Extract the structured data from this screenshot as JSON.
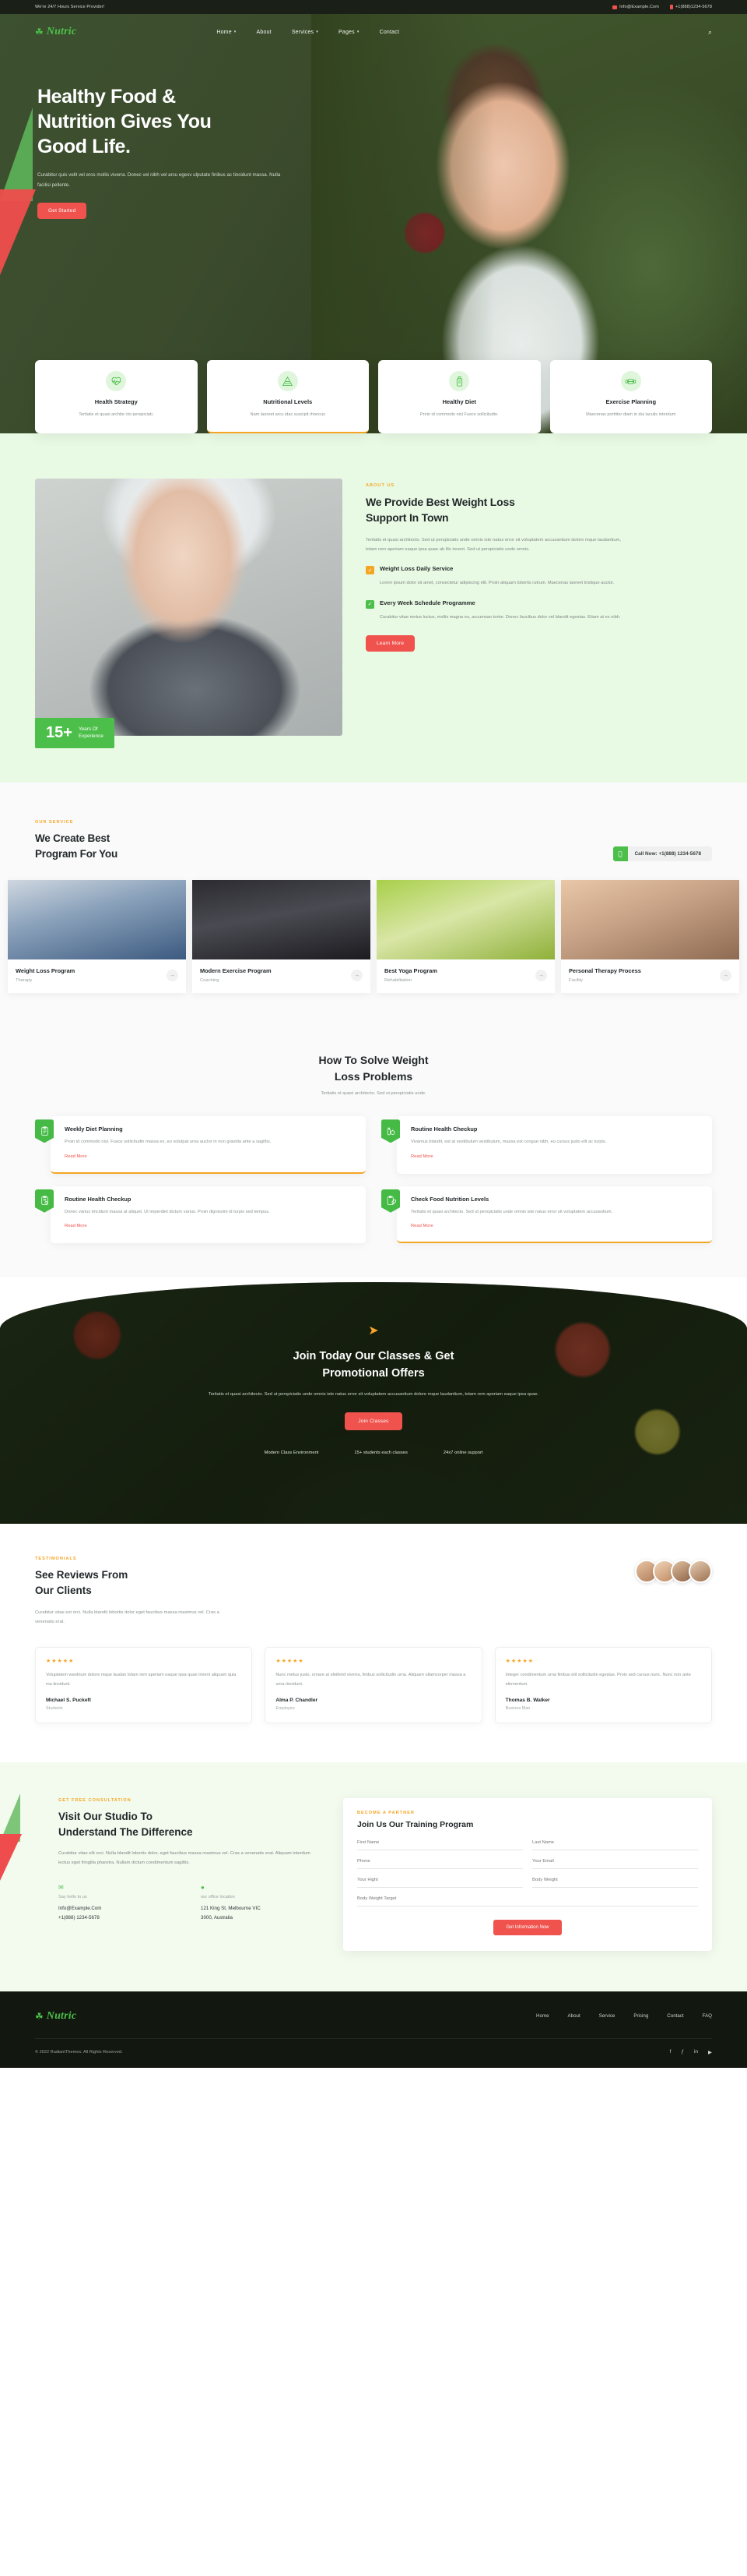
{
  "topbar": {
    "tagline": "We're 24/7 Hours Service Provider!",
    "email": "Info@Example.Com",
    "phone": "+1(888)1234-5678",
    "mail_icon": "mail-icon",
    "phone_icon": "phone-icon"
  },
  "brand": {
    "mark": "☘",
    "name": "Nutric"
  },
  "nav": {
    "items": [
      {
        "label": "Home",
        "caret": "▾"
      },
      {
        "label": "About",
        "caret": ""
      },
      {
        "label": "Services",
        "caret": "▾"
      },
      {
        "label": "Pages",
        "caret": "▾"
      },
      {
        "label": "Contact",
        "caret": ""
      }
    ],
    "search_icon": "⌕"
  },
  "hero": {
    "title": "Healthy Food &\nNutrition Gives You\nGood Life.",
    "desc": "Curabitur quis velit vel eros mollis viverra. Donec vel nibh vel arcu egesv ulputate finibus ac tincidunt massa. Nulla facilisi pellente.",
    "cta": "Get Started"
  },
  "features": [
    {
      "icon": "heartbeat-icon",
      "title": "Health Strategy",
      "desc": "Teritatis et quasi archite cto perspiciati."
    },
    {
      "icon": "food-pyramid-icon",
      "title": "Nutritional Levels",
      "desc": "Nam laoreet arcu idac suscipit rhoncus"
    },
    {
      "icon": "diet-bottle-icon",
      "title": "Healthy Diet",
      "desc": "Proin id commodo nisl Fusce sollicitudin."
    },
    {
      "icon": "dumbbell-icon",
      "title": "Exercise Planning",
      "desc": "Maecenas porttitor diam in dui iaculis interdum"
    }
  ],
  "about": {
    "eyebrow": "ABOUT US",
    "title": "We Provide Best Weight Loss\nSupport In Town",
    "desc": "Teritatis et quasi architecto. Sed ut perspiciatis unde omnis iste natus error sit voluptatem accusantium dolore mque laudantium, totam rem aperiam eaque ipsa quae ab illo invent. Sed ut perspiciatis unde omnis.",
    "badge_number": "15+",
    "badge_label": "Years Of\nExperience",
    "points": [
      {
        "title": "Weight Loss Daily Service",
        "desc": "Lorem ipsum dolor sit amet, consectetur adipiscing elit. Proin aliquam lobortis rutrum. Maecenas laoreet tristique auctor.",
        "color": "#f5a524"
      },
      {
        "title": "Every Week Schedule Programme",
        "desc": "Curabitur vitae metus luctus, mollis magna eu, accumsan tortor. Donec faucibus dolor vel blandit egestas. Etiam at ex nibh.",
        "color": "#4cbf4a"
      }
    ],
    "cta": "Learn More"
  },
  "service": {
    "eyebrow": "OUR SERVICE",
    "title": "We Create Best\nProgram For You",
    "call_label": "Call Now: +1(888) 1234-5678",
    "call_icon": "phone-icon",
    "programs": [
      {
        "title": "Weight Loss Program",
        "sub": "Therapy",
        "arrow": "→"
      },
      {
        "title": "Modern Exercise Program",
        "sub": "Coaching",
        "arrow": "→"
      },
      {
        "title": "Best Yoga Program",
        "sub": "Rehabilitation",
        "arrow": "→"
      },
      {
        "title": "Personal Therapy Process",
        "sub": "Facility",
        "arrow": "→"
      }
    ]
  },
  "solve": {
    "title": "How To Solve Weight\nLoss Problems",
    "subtitle": "Teritatis et quasi architecto. Sed ut perspiciatis unde.",
    "cards": [
      {
        "icon": "clipboard-diet-icon",
        "title": "Weekly Diet Planning",
        "desc": "Proin id commodo nisl. Fusce sollicitudin massa ex, eu volutpat urna auctor in non gravida ante a sagittis.",
        "link": "Read More"
      },
      {
        "icon": "bottle-fruit-icon",
        "title": "Routine Health Checkup",
        "desc": "Vivamus blandit, est at vestibulum vestibulum, massa est congue nibh, eu cursus justo elit ac turpis.",
        "link": "Read More"
      },
      {
        "icon": "clipboard-heart-icon",
        "title": "Routine Health Checkup",
        "desc": "Donec varius tincidunt massa at aliquet. Ut imperdiet dictum varius. Proin dignissim id turpis sed tempus.",
        "link": "Read More"
      },
      {
        "icon": "apple-clipboard-icon",
        "title": "Check Food Nutrition Levels",
        "desc": "Teritatis et quasi architecto. Sed ut perspiciatis unde omnis iste natus error sit voluptatem accusantium.",
        "link": "Read More"
      }
    ]
  },
  "cta": {
    "icon": "paper-plane-icon",
    "title": "Join Today Our Classes & Get\nPromotional Offers",
    "desc": "Teritatis et quasi architecto. Sed ut perspiciatis unde omnis iste natus error sit voluptatem accusantium dolore mque laudantium, totam rem aperiam eaque ipsa quae.",
    "button": "Join Classes",
    "stats": [
      "Modern Class Environment",
      "15+ students each classes",
      "24x7 online support"
    ]
  },
  "testimonials": {
    "eyebrow": "TESTIMONIALS",
    "title": "See Reviews From\nOur Clients",
    "desc": "Curabitur vitae est orci. Nulla blandit lobortis dolor eget faucibus massa maximus vel. Cras a venenatis erat.",
    "cards": [
      {
        "stars": "★★★★★",
        "quote": "Voluptatem wantrium dolore mque laudan totam rem aperiam eaque ipsa quae invent aliquam quia ma tincidunt.",
        "name": "Michael S. Puckeft",
        "role": "Students"
      },
      {
        "stars": "★★★★★",
        "quote": "Nunc metus justo, ornare at eleifend viverra, finibus sollicitudin urna. Aliquam ullamcorper massa a urna tincidunt.",
        "name": "Alma P. Chandler",
        "role": "Employee"
      },
      {
        "stars": "★★★★★",
        "quote": "Integer condimentum urna finibus elit sollicitudin egestas. Proin sed cursus nunc. Nunc non ante elementum.",
        "name": "Thomas B. Walker",
        "role": "Busines Man"
      }
    ]
  },
  "consult": {
    "eyebrow": "GET FREE CONSULTATION",
    "title": "Visit Our Studio To\nUnderstand The Difference",
    "desc": "Curabitur vitae elit orci. Nulla blandit lobortis dolor, eget faucibus massa maximus vel. Cras a venenatis erat. Aliquam interdum lectus eget fringilla pharetra. Nullam dictum condimentum sagittis.",
    "contacts": [
      {
        "icon": "chat-icon",
        "label": "Say hello to us",
        "value": "Info@Example.Com\n+1(888) 1234-5678"
      },
      {
        "icon": "location-icon",
        "label": "our office location",
        "value": "121 King St, Melbourne VIC\n3000, Australia"
      }
    ],
    "form": {
      "eyebrow": "BECOME A PARTNER",
      "title": "Join Us Our Training Program",
      "fields": [
        {
          "placeholder": "First Name",
          "value": "",
          "full": false
        },
        {
          "placeholder": "Last Name",
          "value": "",
          "full": false
        },
        {
          "placeholder": "Phone",
          "value": "",
          "full": false
        },
        {
          "placeholder": "Your Email",
          "value": "",
          "full": false
        },
        {
          "placeholder": "Your Hight",
          "value": "",
          "full": false
        },
        {
          "placeholder": "Body Weight",
          "value": "",
          "full": false
        },
        {
          "placeholder": "Body Weight Target",
          "value": "",
          "full": true
        }
      ],
      "submit": "Get Information Now"
    }
  },
  "footer": {
    "brand_mark": "☘",
    "brand_name": "Nutric",
    "links": [
      "Home",
      "About",
      "Service",
      "Pricing",
      "Contact",
      "FAQ"
    ],
    "copyright": "© 2022 RadiantThemes. All Rights Reserved.",
    "socials": [
      "f",
      "ƒ",
      "in",
      "▶"
    ]
  }
}
